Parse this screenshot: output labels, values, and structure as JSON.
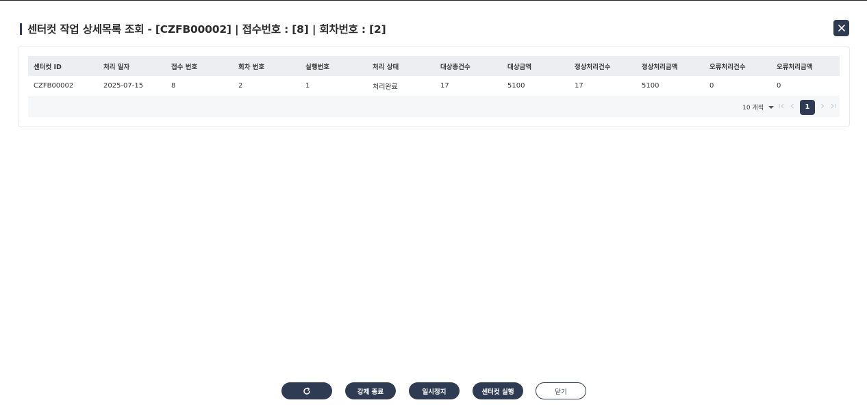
{
  "dialog": {
    "title": "센터컷 작업 상세목록 조회 - [CZFB00002] | 접수번호 : [8] | 회차번호 : [2]"
  },
  "table": {
    "headers": [
      "센터컷 ID",
      "처리 일자",
      "접수 번호",
      "회차 번호",
      "실행번호",
      "처리 상태",
      "대상총건수",
      "대상금액",
      "정상처리건수",
      "정상처리금액",
      "오류처리건수",
      "오류처리금액"
    ],
    "rows": [
      [
        "CZFB00002",
        "2025-07-15",
        "8",
        "2",
        "1",
        "처리완료",
        "17",
        "5100",
        "17",
        "5100",
        "0",
        "0"
      ]
    ]
  },
  "pagination": {
    "page_size_label": "10 개씩",
    "current_page": "1"
  },
  "buttons": {
    "refresh_icon": "refresh-icon",
    "force_stop": "강제 종료",
    "pause": "일시정지",
    "run_centercut": "센터컷 실행",
    "close": "닫기"
  },
  "colors": {
    "primary": "#2f3b52",
    "header_bg": "#eceef1"
  }
}
